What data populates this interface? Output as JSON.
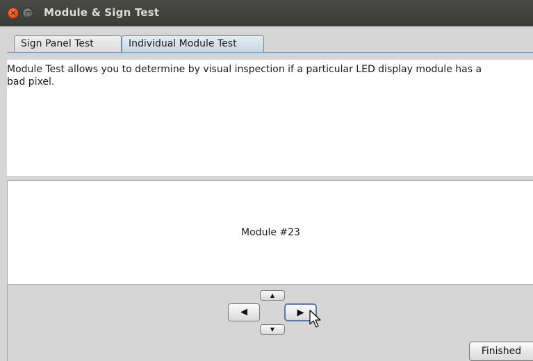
{
  "window": {
    "title": "Module & Sign Test"
  },
  "tabs": [
    {
      "label": "Sign Panel Test",
      "active": false
    },
    {
      "label": "Individual Module Test",
      "active": true
    }
  ],
  "description": "Module Test allows you to determine by visual inspection if a particular LED display module has a bad pixel.",
  "module_display": {
    "label": "Module #23"
  },
  "navigation": {
    "up_icon": "up-arrow-icon",
    "down_icon": "down-arrow-icon",
    "left_icon": "left-arrow-icon",
    "right_icon": "right-arrow-icon"
  },
  "footer": {
    "finished_label": "Finished"
  },
  "colors": {
    "titlebar": "#3f3f3c",
    "close_button": "#e0511c",
    "active_tab": "#c8d6e3",
    "focus_border": "#5a7aa3"
  }
}
